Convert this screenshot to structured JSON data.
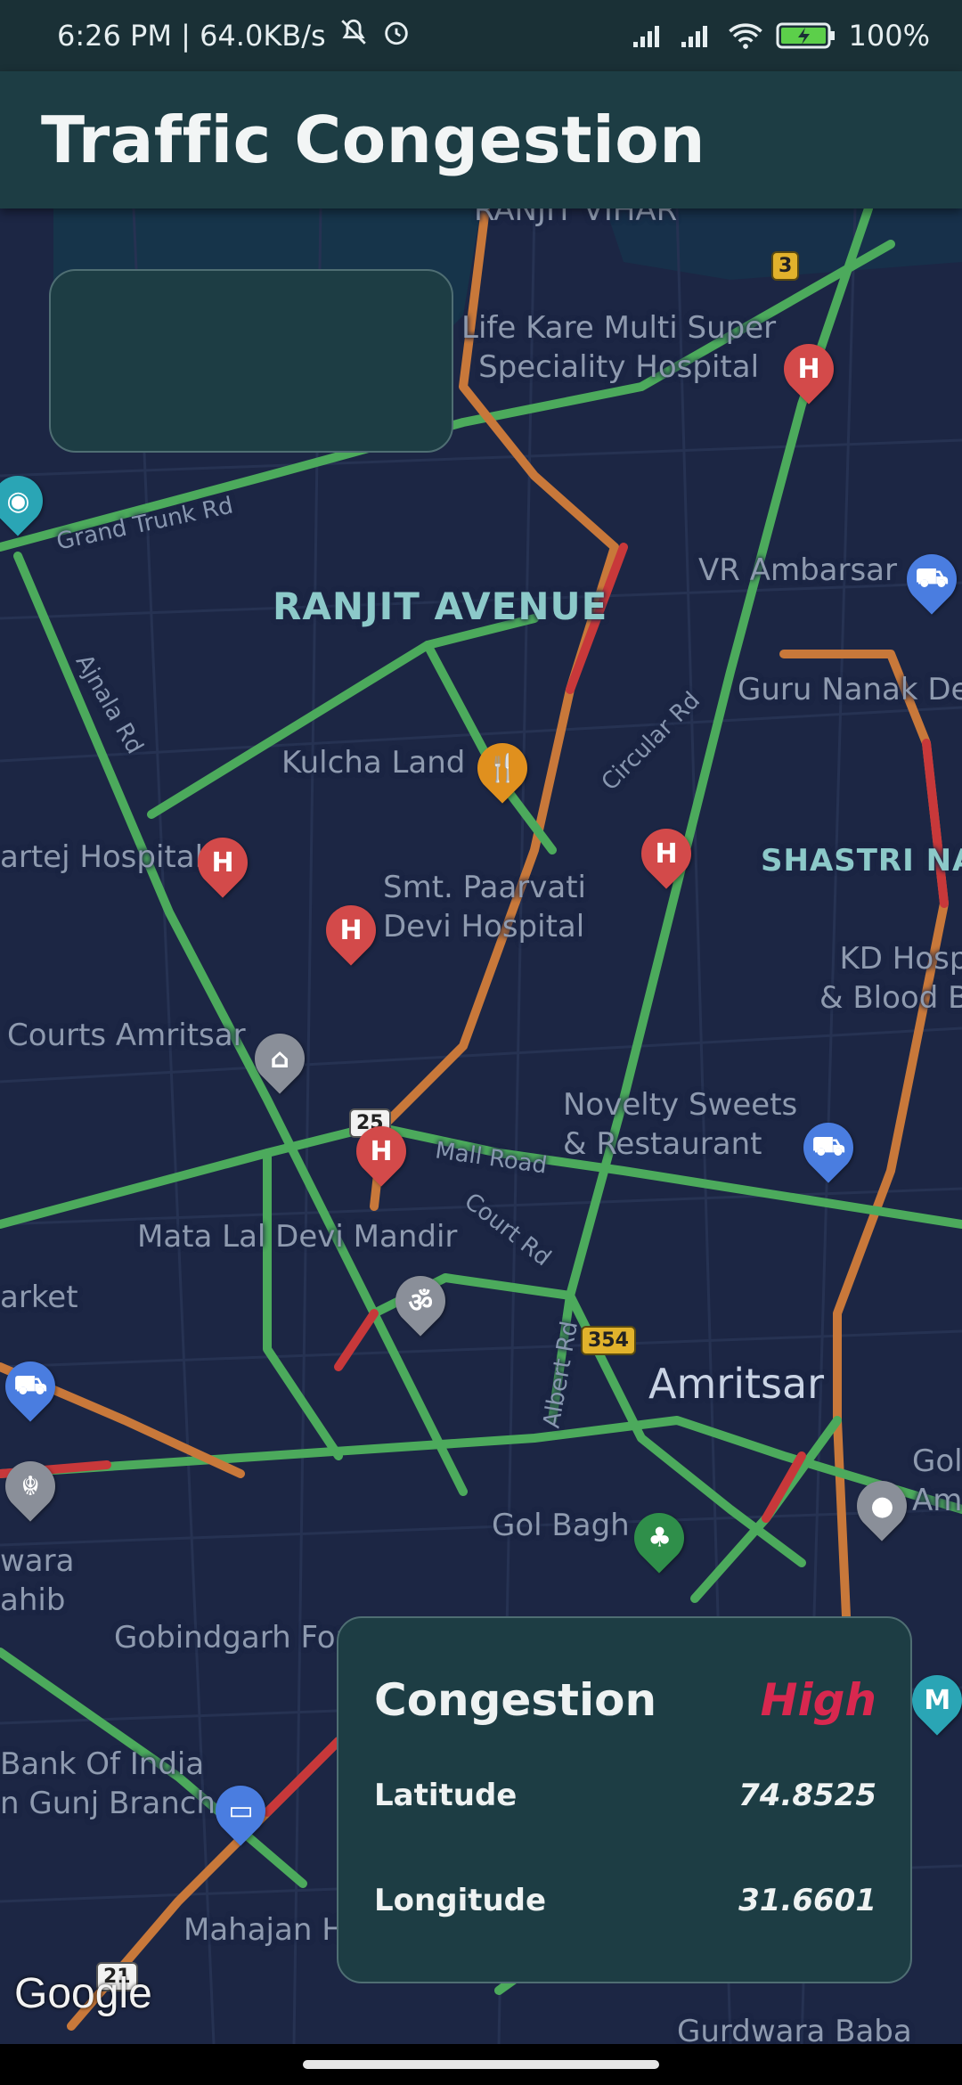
{
  "status_bar": {
    "time_speed": "6:26 PM | 64.0KB/s",
    "battery_percent": "100%"
  },
  "app_bar": {
    "title": "Traffic Congestion"
  },
  "map": {
    "labels": {
      "ranjit_vihar": "RANJIT VIHAR",
      "life_kare": "Life Kare Multi Super\nSpeciality Hospital",
      "grand_trunk": "Grand Trunk Rd",
      "ranjit_avenue": "RANJIT AVENUE",
      "vr_ambarsar": "VR Ambarsar",
      "ajnala_rd": "Ajnala Rd",
      "guru_nanak": "Guru Nanak Dev",
      "circular_rd": "Circular Rd",
      "kulcha_land": "Kulcha Land",
      "fartej": "artej Hospital",
      "shastri": "SHASTRI NAG",
      "paarvati": "Smt. Paarvati\nDevi Hospital",
      "kd_hosp": "KD Hosp\n& Blood B",
      "courts": "Courts Amritsar",
      "novelty": "Novelty Sweets\n& Restaurant",
      "mall_road": "Mall Road",
      "court_rd": "Court Rd",
      "mata_lal": "Mata Lal Devi Mandir",
      "arket": "arket",
      "albert_rd": "Albert Rd",
      "amritsar": "Amritsar",
      "gol": "Gol\nAm",
      "gol_bagh": "Gol Bagh",
      "wara": "wara\nahib",
      "gobindgarh": "Gobindgarh For",
      "bank": "Bank Of India\nn Gunj Branch",
      "mahajan": "Mahajan H",
      "gurdwara": "Gurdwara Baba"
    },
    "shields": {
      "s3": "3",
      "s25": "25",
      "s354": "354",
      "s21": "21"
    },
    "hospital_glyph": "H"
  },
  "info_card": {
    "title": "Congestion",
    "level": "High",
    "level_color": "#d8284f",
    "latitude_label": "Latitude",
    "latitude_value": "74.8525",
    "longitude_label": "Longitude",
    "longitude_value": "31.6601"
  },
  "attribution": "Google"
}
